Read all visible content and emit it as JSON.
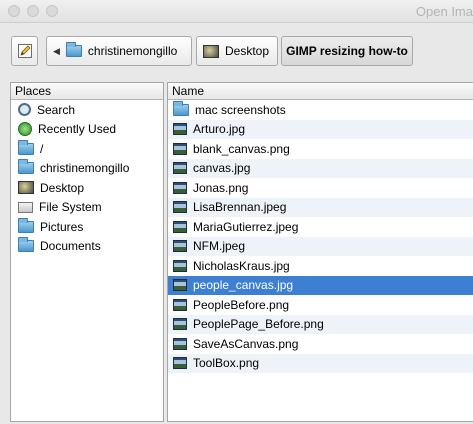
{
  "window": {
    "title": "Open Ima"
  },
  "breadcrumbs": [
    {
      "label": "christinemongillo",
      "icon": "folder-icon"
    },
    {
      "label": "Desktop",
      "icon": "desktop-icon"
    },
    {
      "label": "GIMP resizing how-to",
      "icon": ""
    }
  ],
  "places": {
    "header": "Places",
    "items": [
      {
        "label": "Search",
        "icon": "search-icon"
      },
      {
        "label": "Recently Used",
        "icon": "recent-icon"
      },
      {
        "label": "/",
        "icon": "folder-icon"
      },
      {
        "label": "christinemongillo",
        "icon": "folder-icon"
      },
      {
        "label": "Desktop",
        "icon": "desktop-icon"
      },
      {
        "label": "File System",
        "icon": "drive-icon"
      },
      {
        "label": "Pictures",
        "icon": "folder-icon"
      },
      {
        "label": "Documents",
        "icon": "folder-icon"
      }
    ]
  },
  "files": {
    "header": "Name",
    "selected": "people_canvas.jpg",
    "items": [
      {
        "name": "mac screenshots",
        "type": "folder"
      },
      {
        "name": "Arturo.jpg",
        "type": "image"
      },
      {
        "name": "blank_canvas.png",
        "type": "image"
      },
      {
        "name": "canvas.jpg",
        "type": "image"
      },
      {
        "name": "Jonas.png",
        "type": "image"
      },
      {
        "name": "LisaBrennan.jpeg",
        "type": "image"
      },
      {
        "name": "MariaGutierrez.jpeg",
        "type": "image"
      },
      {
        "name": "NFM.jpeg",
        "type": "image"
      },
      {
        "name": "NicholasKraus.jpg",
        "type": "image"
      },
      {
        "name": "people_canvas.jpg",
        "type": "image"
      },
      {
        "name": "PeopleBefore.png",
        "type": "image"
      },
      {
        "name": "PeoplePage_Before.png",
        "type": "image"
      },
      {
        "name": "SaveAsCanvas.png",
        "type": "image"
      },
      {
        "name": "ToolBox.png",
        "type": "image"
      }
    ]
  },
  "colors": {
    "selection": "#3d7fd1",
    "zebra": "#eef3f9"
  }
}
